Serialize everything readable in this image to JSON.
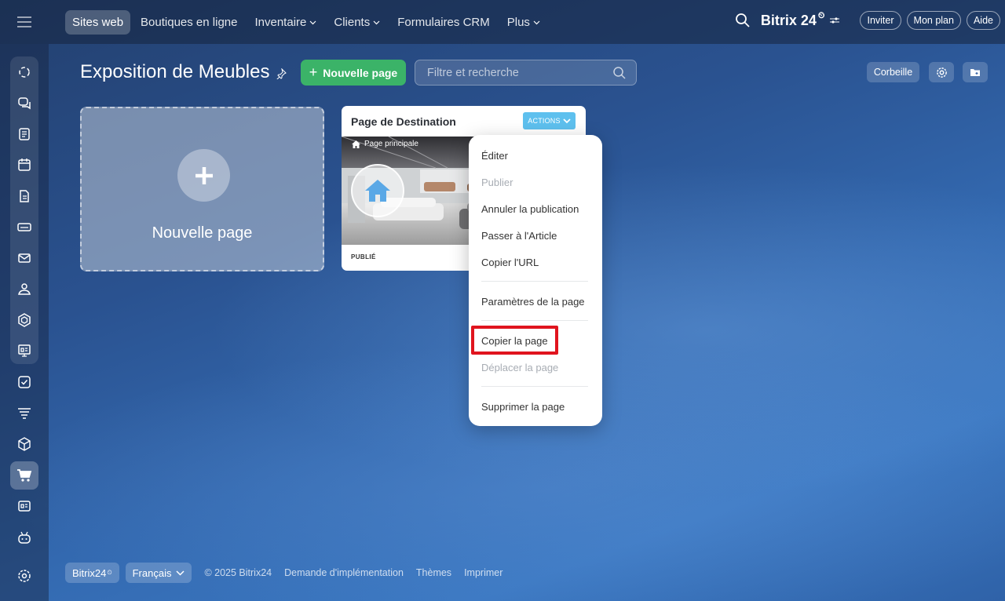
{
  "topbar": {
    "nav": [
      {
        "label": "Sites web",
        "active": true
      },
      {
        "label": "Boutiques en ligne"
      },
      {
        "label": "Inventaire",
        "caret": true
      },
      {
        "label": "Clients",
        "caret": true
      },
      {
        "label": "Formulaires CRM"
      },
      {
        "label": "Plus",
        "caret": true
      }
    ],
    "brand": "Bitrix 24",
    "brand_mark": "⏲",
    "invite": "Inviter",
    "plan": "Mon plan",
    "help": "Aide"
  },
  "header": {
    "title": "Exposition de Meubles",
    "new_page_button": "Nouvelle page",
    "filter_placeholder": "Filtre et recherche",
    "trash_button": "Corbeille"
  },
  "new_tile": {
    "label": "Nouvelle page"
  },
  "card": {
    "title": "Page de Destination",
    "actions_label": "ACTIONS",
    "main_page_label": "Page principale",
    "status": "PUBLIÉ"
  },
  "menu": {
    "items": [
      {
        "label": "Éditer"
      },
      {
        "label": "Publier",
        "disabled": true
      },
      {
        "label": "Annuler la publication"
      },
      {
        "label": "Passer à l'Article"
      },
      {
        "label": "Copier l'URL"
      },
      {
        "label": "Paramètres de la page"
      },
      {
        "label": "Copier la page",
        "highlighted": true
      },
      {
        "label": "Déplacer la page",
        "disabled": true
      },
      {
        "label": "Supprimer la page"
      }
    ]
  },
  "footer": {
    "brand": "Bitrix24",
    "brand_mark": "⏲",
    "language": "Français",
    "copyright": "© 2025 Bitrix24",
    "links": [
      "Demande d'implémentation",
      "Thèmes",
      "Imprimer"
    ]
  },
  "colors": {
    "accent_green": "#3bb368",
    "actions_blue": "#5ec0ee",
    "highlight_red": "#e0141e"
  },
  "icons": {
    "rail": [
      "activity-stream-icon",
      "chat-icon",
      "feed-icon",
      "calendar-icon",
      "documents-icon",
      "drive-icon",
      "mail-icon",
      "contacts-icon",
      "crm-icon",
      "presentation-icon",
      "tasks-icon",
      "funnel-icon",
      "inventory-icon",
      "shop-icon",
      "contact-card-icon",
      "robot-icon",
      "settings-icon"
    ]
  }
}
